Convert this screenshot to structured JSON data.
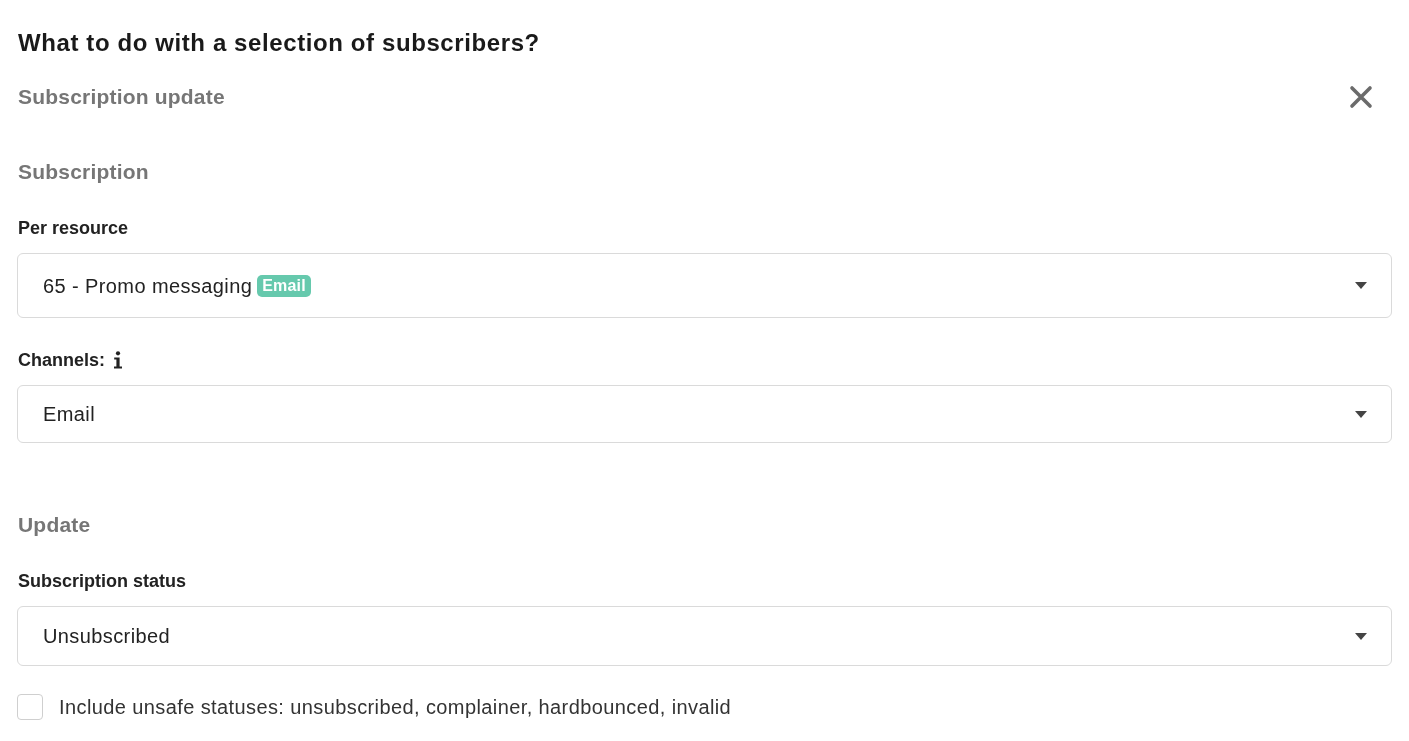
{
  "dialog": {
    "title": "What to do with a selection of subscribers?",
    "subtitle": "Subscription update"
  },
  "sections": [
    {
      "heading": "Subscription",
      "fields": [
        {
          "kind": "select",
          "label": "Per resource",
          "value": "65 - Promo messaging",
          "badge": "Email"
        },
        {
          "kind": "select",
          "label": "Channels:",
          "info": true,
          "value": "Email"
        }
      ]
    },
    {
      "heading": "Update",
      "fields": [
        {
          "kind": "select",
          "label": "Subscription status",
          "value": "Unsubscribed"
        },
        {
          "kind": "checkbox",
          "label": "Include unsafe statuses: unsubscribed, complainer, hardbounced, invalid",
          "checked": false
        }
      ]
    }
  ]
}
